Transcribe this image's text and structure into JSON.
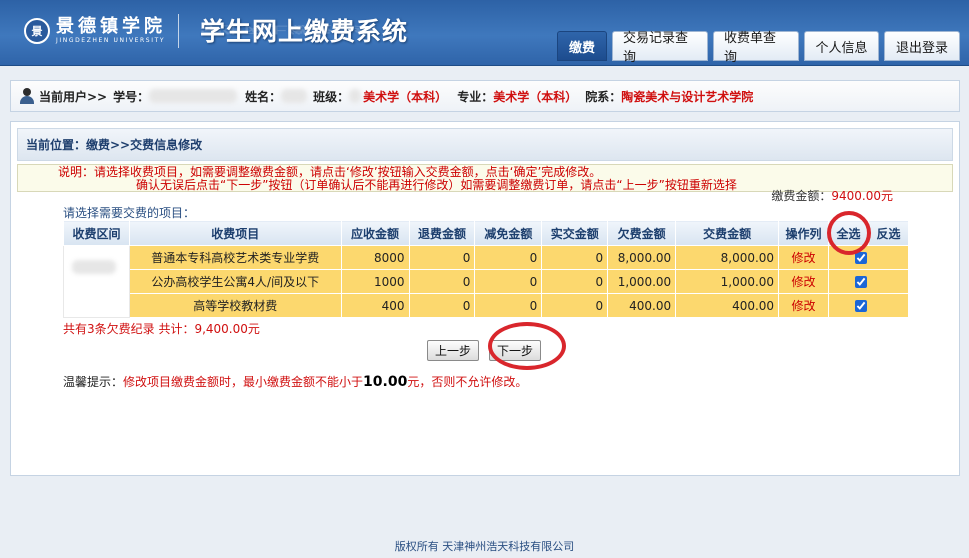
{
  "header": {
    "logo_cn": "景德镇学院",
    "logo_en": "JINGDEZHEN UNIVERSITY",
    "title": "学生网上缴费系统",
    "nav": [
      "缴费",
      "交易记录查询",
      "收费单查询",
      "个人信息",
      "退出登录"
    ]
  },
  "userbar": {
    "current_user": "当前用户>>",
    "student_id_label": "学号：",
    "name_label": "姓名：",
    "class_label": "班级：",
    "class_value": "美术学（本科）",
    "major_label": "专业：",
    "major_value": "美术学（本科）",
    "dept_label": "院系：",
    "dept_value": "陶瓷美术与设计艺术学院"
  },
  "main": {
    "breadcrumb": "当前位置：缴费>>交费信息修改",
    "notice_line1": "说明：请选择收费项目，如需要调整缴费金额，请点击‘修改’按钮输入交费金额，点击‘确定’完成修改。",
    "notice_line2": "确认无误后点击“下一步”按钮（订单确认后不能再进行修改）如需要调整缴费订单，请点击“上一步”按钮重新选择",
    "amount_label": "缴费金额：",
    "amount_value": "9400.00元",
    "select_label": "请选择需要交费的项目：",
    "table": {
      "headers": [
        "收费区间",
        "收费项目",
        "应收金额",
        "退费金额",
        "减免金额",
        "实交金额",
        "欠费金额",
        "交费金额",
        "操作列",
        "全选",
        "反选"
      ],
      "rows": [
        {
          "item": "普通本专科高校艺术类专业学费",
          "due": "8000",
          "refund": "0",
          "waiver": "0",
          "paid": "0",
          "owed": "8,000.00",
          "pay": "8,000.00",
          "op": "修改"
        },
        {
          "item": "公办高校学生公寓4人/间及以下",
          "due": "1000",
          "refund": "0",
          "waiver": "0",
          "paid": "0",
          "owed": "1,000.00",
          "pay": "1,000.00",
          "op": "修改"
        },
        {
          "item": "高等学校教材费",
          "due": "400",
          "refund": "0",
          "waiver": "0",
          "paid": "0",
          "owed": "400.00",
          "pay": "400.00",
          "op": "修改"
        }
      ]
    },
    "summary": "共有3条欠费纪录  共计：9,400.00元",
    "prev_button": "上一步",
    "next_button": "下一步",
    "tip_prefix": "温馨提示：",
    "tip_red1": "修改项目缴费金额时，最小缴费金额不能小于",
    "tip_bold": "10.00",
    "tip_red2": "元，否则不允许修改。"
  },
  "footer": "版权所有 天津神州浩天科技有限公司",
  "colors": {
    "header_blue": "#3a70b5",
    "row_yellow": "#fcd86e",
    "alert_red": "#d01010",
    "annotation_red": "#d9262c"
  }
}
